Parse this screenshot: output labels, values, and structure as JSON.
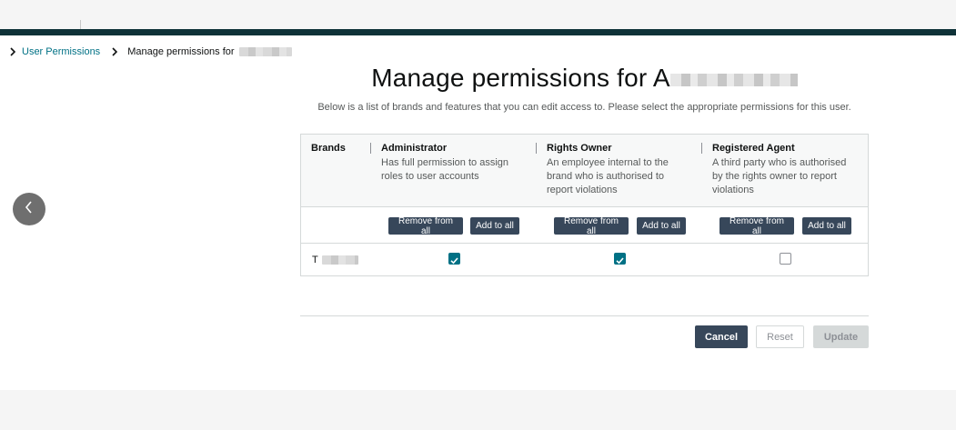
{
  "breadcrumb": {
    "parent_label": "User Permissions",
    "current_label": "Manage permissions for"
  },
  "page": {
    "title": "Manage permissions for A",
    "subtitle": "Below is a list of brands and features that you can edit access to. Please select the appropriate permissions for this user."
  },
  "table": {
    "brands_header": "Brands",
    "roles": [
      {
        "name": "Administrator",
        "description": "Has full permission to assign roles to user accounts",
        "remove_label": "Remove from all",
        "add_label": "Add to all"
      },
      {
        "name": "Rights Owner",
        "description": "An employee internal to the brand who is authorised to report violations",
        "remove_label": "Remove from all",
        "add_label": "Add to all"
      },
      {
        "name": "Registered Agent",
        "description": "A third party who is authorised by the rights owner to report violations",
        "remove_label": "Remove from all",
        "add_label": "Add to all"
      }
    ],
    "rows": [
      {
        "brand": "T",
        "administrator": true,
        "rights_owner": true,
        "registered_agent": false
      }
    ]
  },
  "footer": {
    "cancel_label": "Cancel",
    "reset_label": "Reset",
    "update_label": "Update"
  },
  "colors": {
    "header_bar": "#0f3238",
    "link": "#007185",
    "dark_button": "#37475a",
    "checkbox_checked": "#007185"
  }
}
